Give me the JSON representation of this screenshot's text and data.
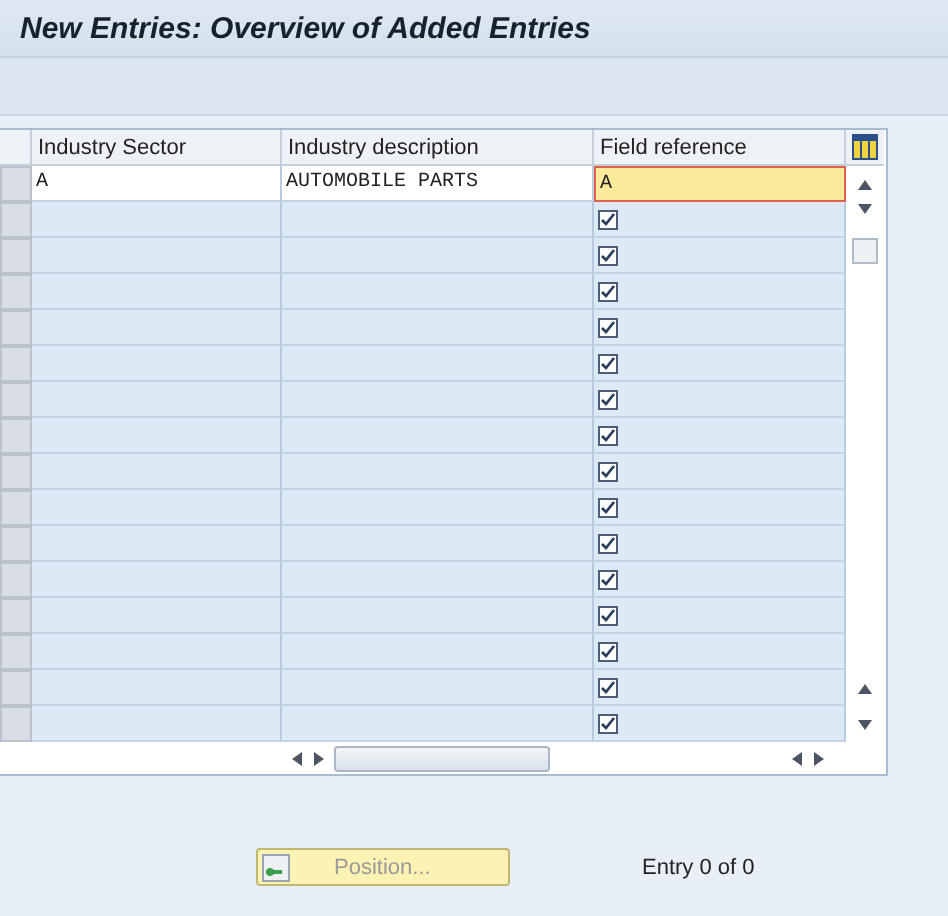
{
  "window": {
    "title": "New Entries: Overview of Added Entries"
  },
  "table": {
    "columns": [
      "Industry Sector",
      "Industry description",
      "Field reference"
    ],
    "rows": [
      {
        "kind": "entry",
        "industry_sector": "A",
        "industry_description": "AUTOMOBILE PARTS",
        "field_reference": "A"
      },
      {
        "kind": "empty",
        "checked": true
      },
      {
        "kind": "empty",
        "checked": true
      },
      {
        "kind": "empty",
        "checked": true
      },
      {
        "kind": "empty",
        "checked": true
      },
      {
        "kind": "empty",
        "checked": true
      },
      {
        "kind": "empty",
        "checked": true
      },
      {
        "kind": "empty",
        "checked": true
      },
      {
        "kind": "empty",
        "checked": true
      },
      {
        "kind": "empty",
        "checked": true
      },
      {
        "kind": "empty",
        "checked": true
      },
      {
        "kind": "empty",
        "checked": true
      },
      {
        "kind": "empty",
        "checked": true
      },
      {
        "kind": "empty",
        "checked": true
      },
      {
        "kind": "empty",
        "checked": true
      },
      {
        "kind": "empty",
        "checked": true
      }
    ]
  },
  "footer": {
    "position_button": "Position...",
    "entry_count": "Entry 0 of 0"
  }
}
